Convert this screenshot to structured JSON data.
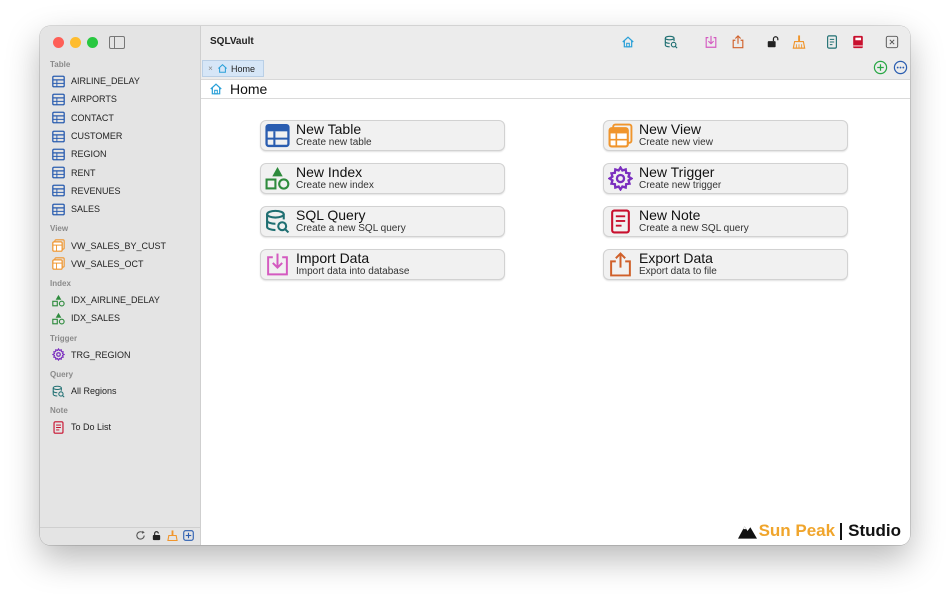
{
  "app": {
    "title": "SQLVault"
  },
  "colors": {
    "table": "#2a5db0",
    "view": "#f0952c",
    "index": "#2e8b3d",
    "trigger": "#7b2fbf",
    "query": "#1f6f72",
    "note": "#c8102e",
    "import": "#d45ac0",
    "export": "#d0602a",
    "home": "#2aa0d8"
  },
  "sidebar": {
    "sections": [
      {
        "title": "Table",
        "icon": "table-icon",
        "items": [
          "AIRLINE_DELAY",
          "AIRPORTS",
          "CONTACT",
          "CUSTOMER",
          "REGION",
          "RENT",
          "REVENUES",
          "SALES"
        ]
      },
      {
        "title": "View",
        "icon": "view-icon",
        "items": [
          "VW_SALES_BY_CUST",
          "VW_SALES_OCT"
        ]
      },
      {
        "title": "Index",
        "icon": "index-icon",
        "items": [
          "IDX_AIRLINE_DELAY",
          "IDX_SALES"
        ]
      },
      {
        "title": "Trigger",
        "icon": "trigger-gear-icon",
        "items": [
          "TRG_REGION"
        ]
      },
      {
        "title": "Query",
        "icon": "query-icon",
        "items": [
          "All Regions"
        ]
      },
      {
        "title": "Note",
        "icon": "note-icon",
        "items": [
          "To Do List"
        ]
      }
    ],
    "bottom_icons": [
      "refresh-icon",
      "lock-icon",
      "broom-icon",
      "add-square-icon"
    ]
  },
  "toolbar": {
    "icons": [
      "home-icon",
      "query-icon",
      "import-icon",
      "export-icon",
      "lock-icon",
      "broom-icon",
      "note-icon",
      "book-icon",
      "close-window-icon"
    ]
  },
  "tabs": [
    {
      "label": "Home",
      "icon": "home-icon"
    }
  ],
  "page": {
    "title": "Home"
  },
  "actions": [
    {
      "title": "New Table",
      "subtitle": "Create new table",
      "icon": "table-icon"
    },
    {
      "title": "New View",
      "subtitle": "Create new view",
      "icon": "view-icon"
    },
    {
      "title": "New Index",
      "subtitle": "Create new index",
      "icon": "index-icon"
    },
    {
      "title": "New Trigger",
      "subtitle": "Create new trigger",
      "icon": "trigger-gear-icon"
    },
    {
      "title": "SQL Query",
      "subtitle": "Create a new SQL query",
      "icon": "query-icon"
    },
    {
      "title": "New Note",
      "subtitle": "Create a new SQL query",
      "icon": "note-icon"
    },
    {
      "title": "Import Data",
      "subtitle": "Import data into database",
      "icon": "import-icon"
    },
    {
      "title": "Export Data",
      "subtitle": "Export data to file",
      "icon": "export-icon"
    }
  ],
  "brand": {
    "name": "Sun Peak",
    "suffix": "Studio"
  }
}
